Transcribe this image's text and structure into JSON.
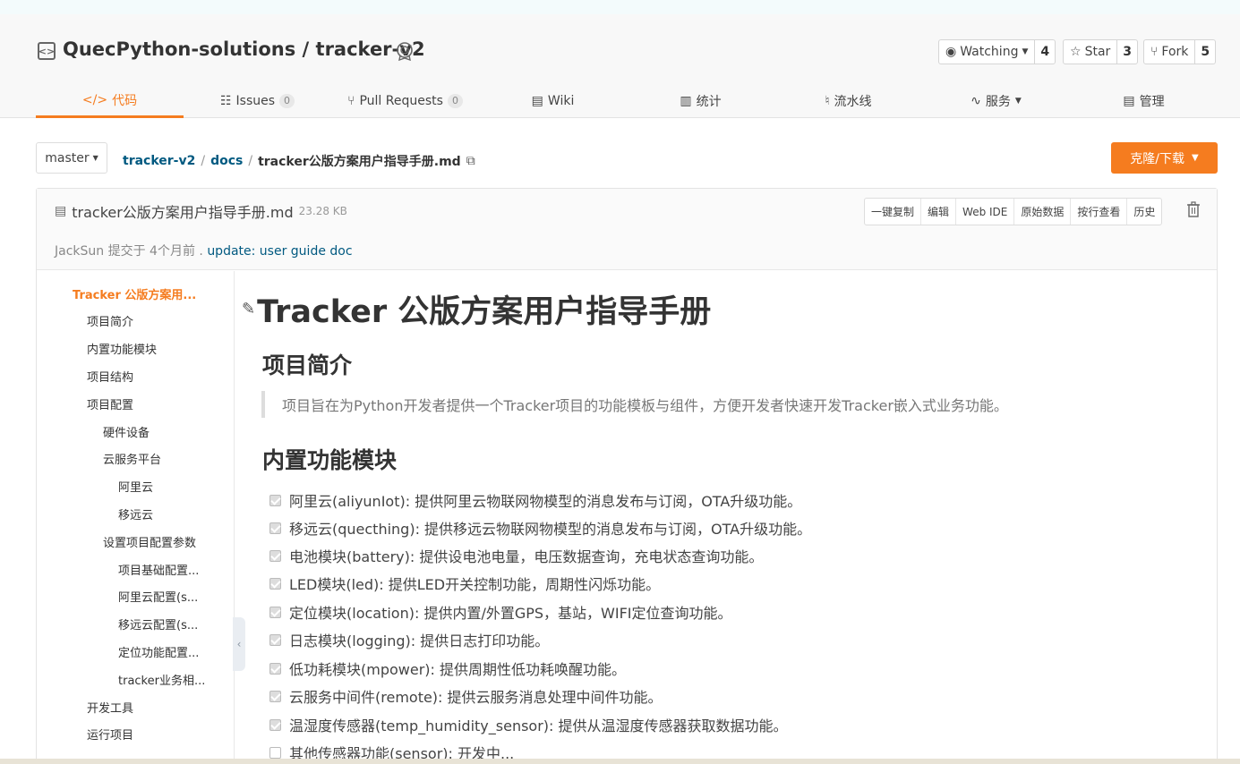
{
  "repo": {
    "title": "QuecPython-solutions / tracker-v2",
    "watch": {
      "label": "Watching",
      "count": "4"
    },
    "star": {
      "label": "Star",
      "count": "3"
    },
    "fork": {
      "label": "Fork",
      "count": "5"
    }
  },
  "tabs": [
    {
      "label": "代码",
      "icon": "code-icon"
    },
    {
      "label": "Issues",
      "count": "0",
      "icon": "issues-icon"
    },
    {
      "label": "Pull Requests",
      "count": "0",
      "icon": "pull-request-icon"
    },
    {
      "label": "Wiki",
      "icon": "book-icon"
    },
    {
      "label": "统计",
      "icon": "chart-icon"
    },
    {
      "label": "流水线",
      "icon": "pipeline-icon"
    },
    {
      "label": "服务",
      "icon": "pulse-icon"
    },
    {
      "label": "管理",
      "icon": "settings-doc-icon"
    }
  ],
  "branch": "master",
  "breadcrumb": {
    "repo": "tracker-v2",
    "dir": "docs",
    "file": "tracker公版方案用户指导手册.md"
  },
  "clone_label": "克隆/下载",
  "file": {
    "name": "tracker公版方案用户指导手册.md",
    "size": "23.28 KB",
    "actions": [
      "一键复制",
      "编辑",
      "Web IDE",
      "原始数据",
      "按行查看",
      "历史"
    ],
    "commit_author": "JackSun 提交于 4个月前 . ",
    "commit_msg": "update: user guide doc"
  },
  "toc": [
    "Tracker 公版方案用...",
    "项目简介",
    "内置功能模块",
    "项目结构",
    "项目配置",
    "硬件设备",
    "云服务平台",
    "阿里云",
    "移远云",
    "设置项目配置参数",
    "项目基础配置...",
    "阿里云配置(s...",
    "移远云配置(s...",
    "定位功能配置...",
    "tracker业务相...",
    "开发工具",
    "运行项目"
  ],
  "doc": {
    "h1": "Tracker 公版方案用户指导手册",
    "h2_intro": "项目简介",
    "intro_quote": "项目旨在为Python开发者提供一个Tracker项目的功能模板与组件，方便开发者快速开发Tracker嵌入式业务功能。",
    "h2_modules": "内置功能模块",
    "tasks": [
      "阿里云(aliyunIot): 提供阿里云物联网物模型的消息发布与订阅，OTA升级功能。",
      "移远云(quecthing): 提供移远云物联网物模型的消息发布与订阅，OTA升级功能。",
      "电池模块(battery): 提供设电池电量，电压数据查询，充电状态查询功能。",
      "LED模块(led): 提供LED开关控制功能，周期性闪烁功能。",
      "定位模块(location): 提供内置/外置GPS，基站，WIFI定位查询功能。",
      "日志模块(logging): 提供日志打印功能。",
      "低功耗模块(mpower): 提供周期性低功耗唤醒功能。",
      "云服务中间件(remote): 提供云服务消息处理中间件功能。",
      "温湿度传感器(temp_humidity_sensor): 提供从温湿度传感器获取数据功能。",
      "其他传感器功能(sensor): 开发中..."
    ],
    "task_checked": [
      true,
      true,
      true,
      true,
      true,
      true,
      true,
      true,
      true,
      false
    ]
  },
  "colors": {
    "accent": "#f57c1f",
    "link": "#005980"
  }
}
